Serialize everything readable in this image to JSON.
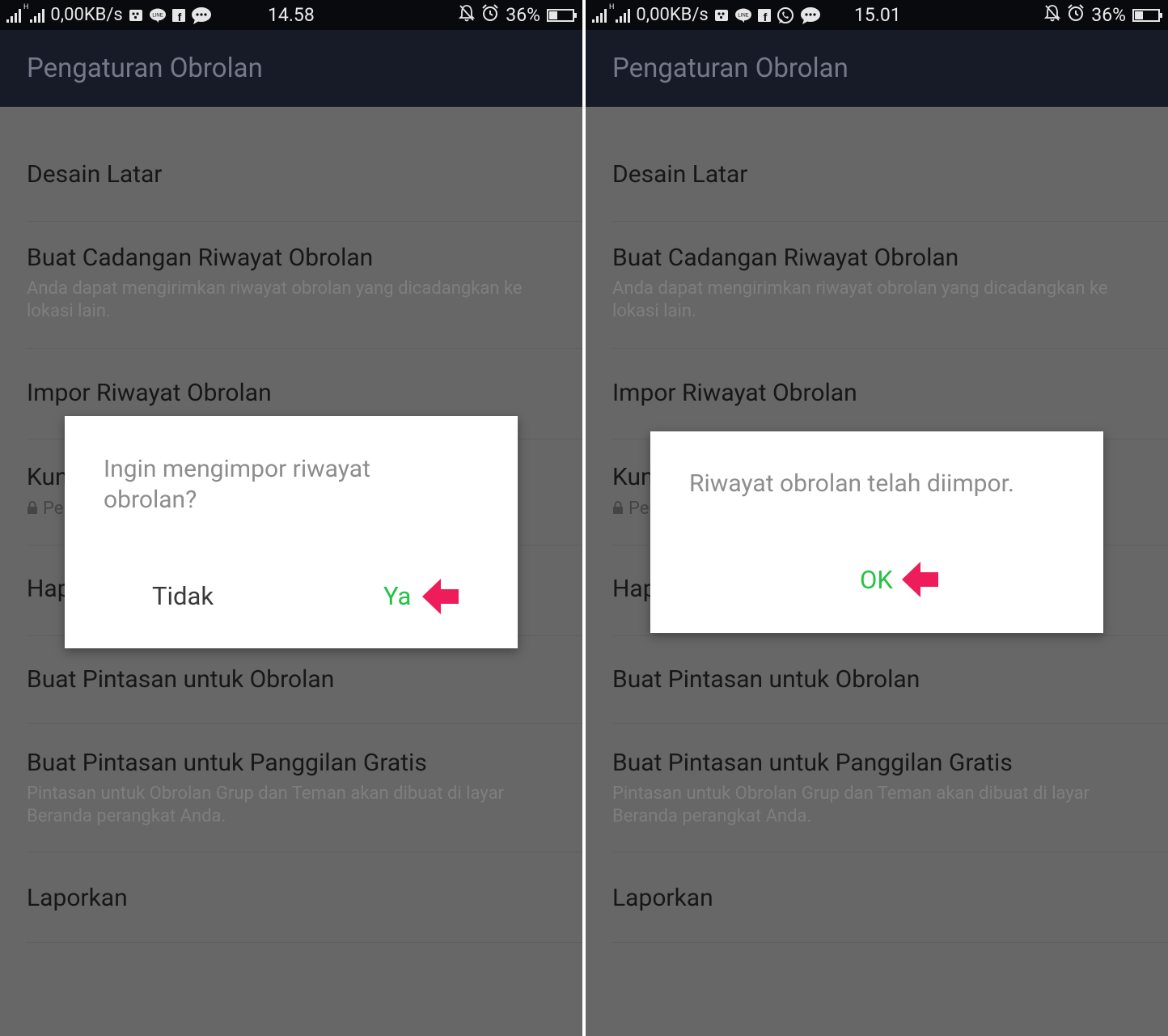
{
  "screens": [
    {
      "status": {
        "net_speed": "0,00KB/s",
        "time": "14.58",
        "battery": "36%",
        "battery_level": 0.36
      },
      "appbar_title": "Pengaturan Obrolan",
      "items": {
        "bg_design": "Desain Latar",
        "backup_title": "Buat Cadangan Riwayat Obrolan",
        "backup_desc": "Anda dapat mengirimkan riwayat obrolan yang dicadangkan ke lokasi lain.",
        "import_title": "Impor Riwayat Obrolan",
        "key_title_visible": "Kun",
        "key_desc_visible": "Pe",
        "delete_title_visible": "Hap",
        "shortcut_chat": "Buat Pintasan untuk Obrolan",
        "shortcut_call_title": "Buat Pintasan untuk Panggilan Gratis",
        "shortcut_call_desc": "Pintasan untuk Obrolan Grup dan Teman akan dibuat di layar Beranda perangkat Anda.",
        "report": "Laporkan"
      },
      "dialog": {
        "message": "Ingin mengimpor riwayat obrolan?",
        "negative": "Tidak",
        "positive": "Ya"
      }
    },
    {
      "status": {
        "net_speed": "0,00KB/s",
        "time": "15.01",
        "battery": "36%",
        "battery_level": 0.36
      },
      "appbar_title": "Pengaturan Obrolan",
      "items": {
        "bg_design": "Desain Latar",
        "backup_title": "Buat Cadangan Riwayat Obrolan",
        "backup_desc": "Anda dapat mengirimkan riwayat obrolan yang dicadangkan ke lokasi lain.",
        "import_title": "Impor Riwayat Obrolan",
        "key_title_visible": "Kun",
        "key_desc_visible": "Pe",
        "delete_title_visible": "Hap",
        "shortcut_chat": "Buat Pintasan untuk Obrolan",
        "shortcut_call_title": "Buat Pintasan untuk Panggilan Gratis",
        "shortcut_call_desc": "Pintasan untuk Obrolan Grup dan Teman akan dibuat di layar Beranda perangkat Anda.",
        "report": "Laporkan"
      },
      "dialog": {
        "message": "Riwayat obrolan telah diimpor.",
        "positive": "OK"
      }
    }
  ],
  "colors": {
    "accent_green": "#20c342",
    "arrow_pink": "#ee1c5b",
    "appbar_bg": "#171b27",
    "dim_bg": "#676767"
  }
}
